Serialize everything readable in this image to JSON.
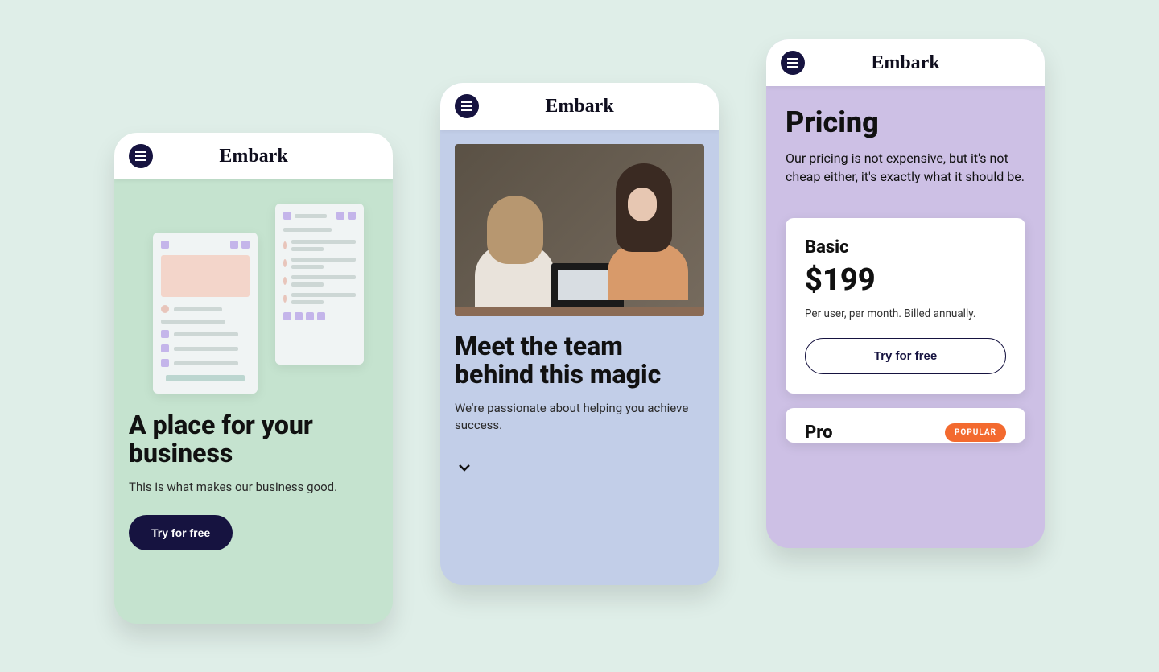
{
  "brand": "Embark",
  "phone1": {
    "heading": "A place for your business",
    "subheading": "This is what makes our business good.",
    "cta": "Try for free"
  },
  "phone2": {
    "heading": "Meet the team behind this magic",
    "subheading": "We're passionate about helping you achieve success."
  },
  "phone3": {
    "title": "Pricing",
    "intro": "Our pricing is not expensive, but it's not cheap either, it's exactly what it should be.",
    "plan1": {
      "name": "Basic",
      "price": "$199",
      "note": "Per user, per month. Billed annually.",
      "cta": "Try for free"
    },
    "plan2": {
      "name": "Pro",
      "badge": "POPULAR"
    }
  }
}
